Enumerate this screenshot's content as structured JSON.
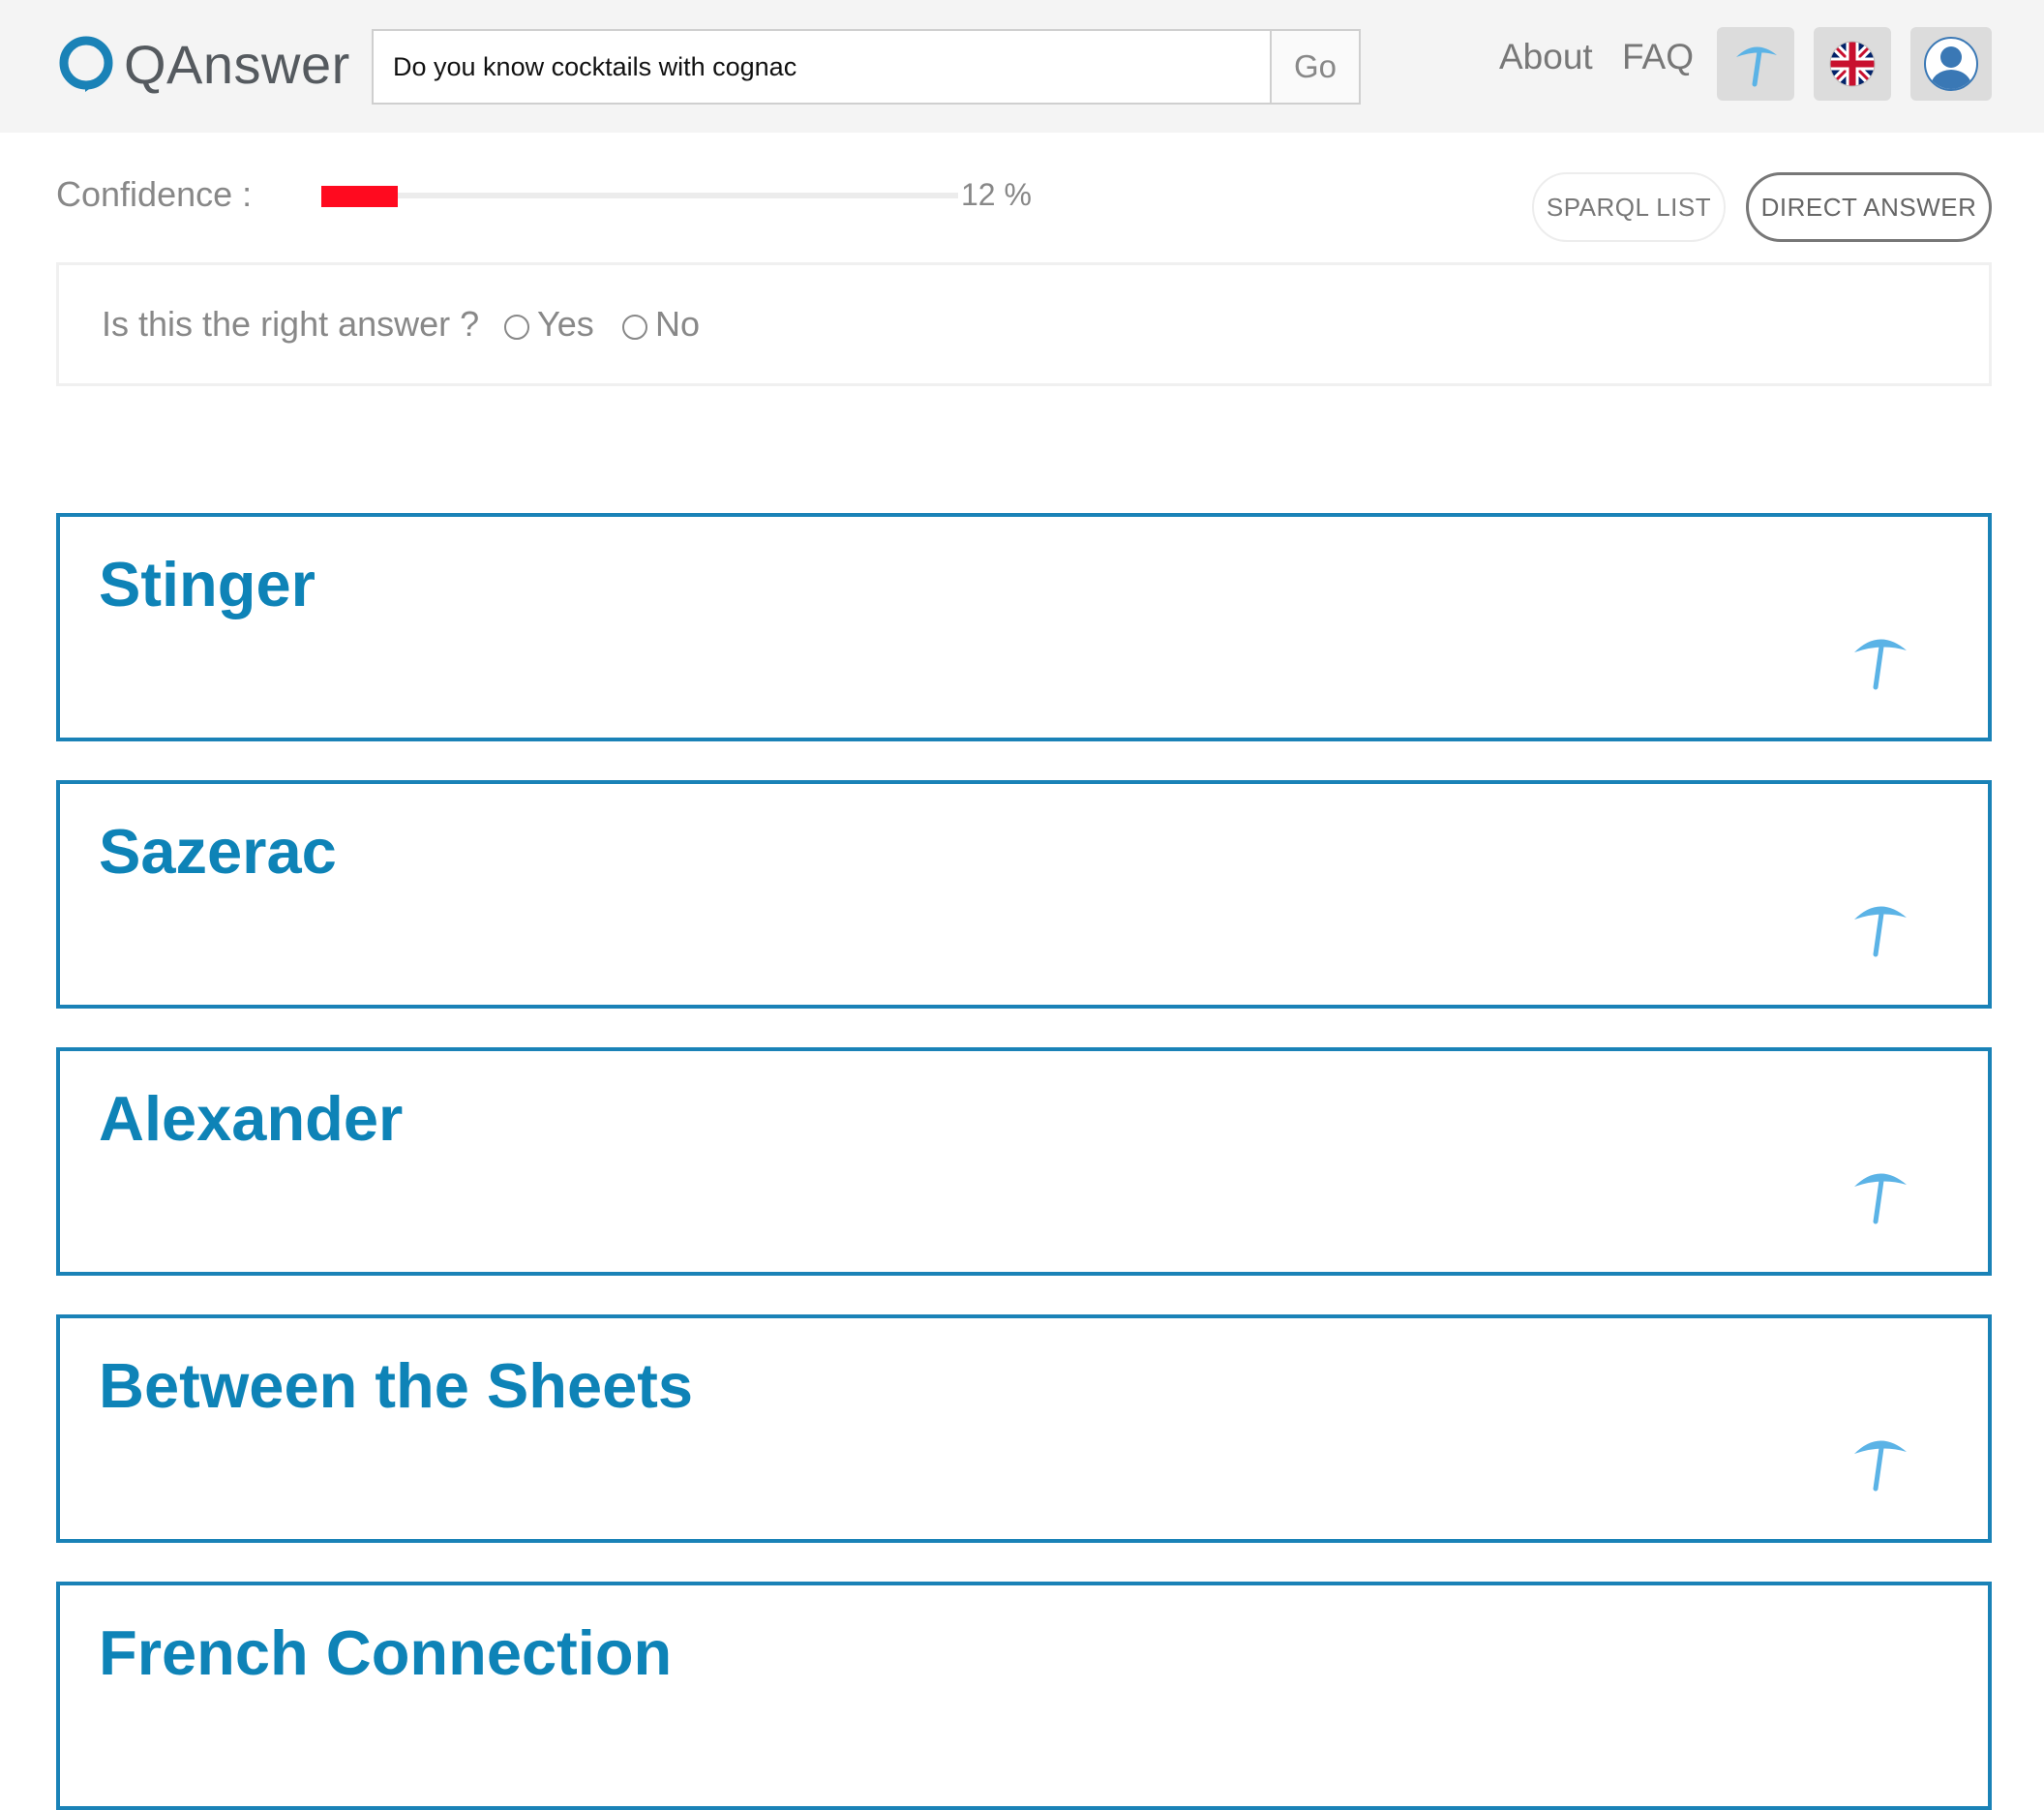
{
  "header": {
    "logo_text": "QAnswer",
    "search": {
      "value": "Do you know cocktails with cognac",
      "go_label": "Go"
    },
    "nav": {
      "about": "About",
      "faq": "FAQ"
    },
    "icons": {
      "umbrella": "umbrella-icon",
      "language": "uk-flag-icon",
      "user": "user-avatar-icon"
    }
  },
  "confidence": {
    "label": "Confidence :",
    "percent": 12,
    "value_text": "12 %",
    "bar_color": "#ff0a1f"
  },
  "actions": {
    "sparql_list": "SPARQL LIST",
    "direct_answer": "DIRECT ANSWER"
  },
  "feedback": {
    "question": "Is this the right answer ?",
    "yes": "Yes",
    "no": "No"
  },
  "results": [
    {
      "title": "Stinger"
    },
    {
      "title": "Sazerac"
    },
    {
      "title": "Alexander"
    },
    {
      "title": "Between the Sheets"
    },
    {
      "title": "French Connection"
    }
  ],
  "colors": {
    "accent": "#0e83b7",
    "card_border": "#1a82b7",
    "umbrella": "#5bb3e6"
  }
}
